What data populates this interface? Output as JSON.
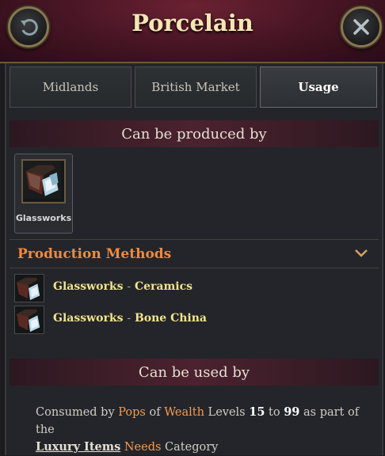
{
  "window": {
    "title": "Porcelain"
  },
  "tabs": [
    {
      "label": "Midlands"
    },
    {
      "label": "British Market"
    },
    {
      "label": "Usage"
    }
  ],
  "produced_section": {
    "header": "Can be produced by",
    "buildings": [
      {
        "label": "Glassworks",
        "icon": "glassworks-icon"
      }
    ]
  },
  "production_methods": {
    "header": "Production Methods",
    "items": [
      {
        "building": "Glassworks",
        "separator": "-",
        "method": "Ceramics",
        "icon": "glassworks-icon"
      },
      {
        "building": "Glassworks",
        "separator": "-",
        "method": "Bone China",
        "icon": "glassworks-icon"
      }
    ]
  },
  "used_section": {
    "header": "Can be used by",
    "text": {
      "p1": "Consumed by ",
      "pops": "Pops",
      "p2": " of ",
      "wealth": "Wealth",
      "p3": " Levels ",
      "min": "15",
      "p4": " to ",
      "max": "99",
      "p5": " as part of the",
      "luxury": "Luxury Items",
      "needs": "Needs",
      "p6": " Category"
    }
  },
  "colors": {
    "title": "#f4e6b4",
    "accent_orange": "#f08a40",
    "method_yellow": "#f2e48a",
    "header_bg": "#4a1626"
  },
  "icons": [
    "back-icon",
    "close-icon",
    "chevron-down-icon",
    "glassworks-icon"
  ]
}
